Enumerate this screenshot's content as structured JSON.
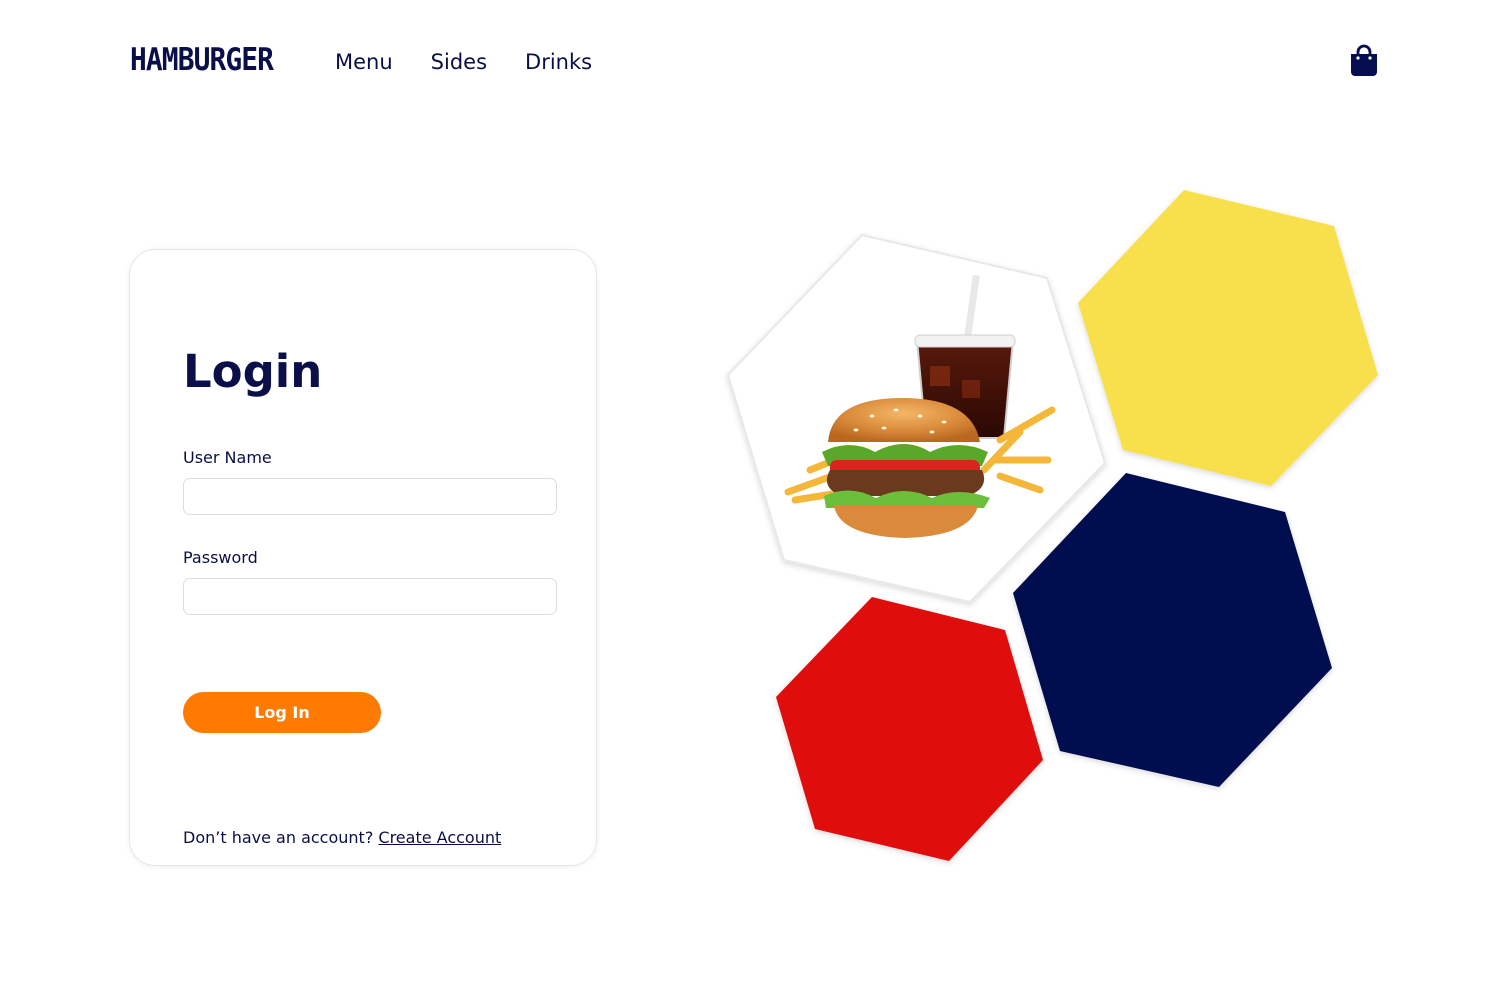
{
  "header": {
    "logo": "HAMBURGER",
    "nav": [
      "Menu",
      "Sides",
      "Drinks"
    ],
    "cart_icon": "shopping-bag-icon"
  },
  "login": {
    "title": "Login",
    "username_label": "User Name",
    "username_value": "",
    "password_label": "Password",
    "password_value": "",
    "submit_label": "Log In",
    "signup_prompt": "Don’t have an account?",
    "signup_link": "Create Account"
  },
  "colors": {
    "navy": "#050c4f",
    "yellow": "#f7e04b",
    "red": "#e0100f",
    "orange": "#ff7a00"
  }
}
